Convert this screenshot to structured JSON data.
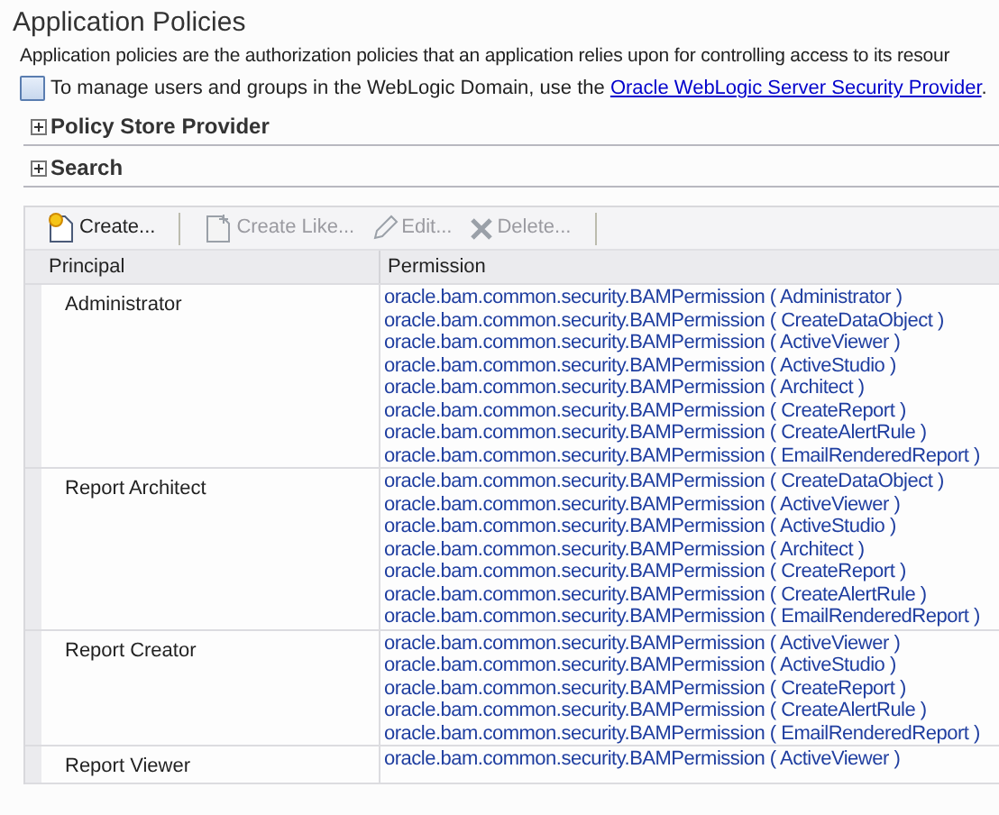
{
  "page_title": "Application Policies",
  "description": "Application policies are the authorization policies that an application relies upon for controlling access to its resour",
  "info": {
    "text": "To manage users and groups in the WebLogic Domain, use the ",
    "link": "Oracle WebLogic Server Security Provider",
    "after": "."
  },
  "sections": [
    {
      "label": "Policy Store Provider",
      "expanded": false
    },
    {
      "label": "Search",
      "expanded": false
    }
  ],
  "toolbar": [
    {
      "kind": "create",
      "label": "Create...",
      "disabled": false
    },
    {
      "kind": "create_like",
      "label": "Create Like...",
      "disabled": true
    },
    {
      "kind": "edit",
      "label": "Edit...",
      "disabled": true
    },
    {
      "kind": "delete",
      "label": "Delete...",
      "disabled": true
    }
  ],
  "table": {
    "columns": [
      "Principal",
      "Permission"
    ],
    "rows": [
      {
        "principal": "Administrator",
        "permissions": [
          "oracle.bam.common.security.BAMPermission ( Administrator )",
          "oracle.bam.common.security.BAMPermission ( CreateDataObject )",
          "oracle.bam.common.security.BAMPermission ( ActiveViewer )",
          "oracle.bam.common.security.BAMPermission ( ActiveStudio )",
          "oracle.bam.common.security.BAMPermission ( Architect )",
          "oracle.bam.common.security.BAMPermission ( CreateReport )",
          "oracle.bam.common.security.BAMPermission ( CreateAlertRule )",
          "oracle.bam.common.security.BAMPermission ( EmailRenderedReport )"
        ]
      },
      {
        "principal": "Report Architect",
        "permissions": [
          "oracle.bam.common.security.BAMPermission ( CreateDataObject )",
          "oracle.bam.common.security.BAMPermission ( ActiveViewer )",
          "oracle.bam.common.security.BAMPermission ( ActiveStudio )",
          "oracle.bam.common.security.BAMPermission ( Architect )",
          "oracle.bam.common.security.BAMPermission ( CreateReport )",
          "oracle.bam.common.security.BAMPermission ( CreateAlertRule )",
          "oracle.bam.common.security.BAMPermission ( EmailRenderedReport )"
        ]
      },
      {
        "principal": "Report Creator",
        "permissions": [
          "oracle.bam.common.security.BAMPermission ( ActiveViewer )",
          "oracle.bam.common.security.BAMPermission ( ActiveStudio )",
          "oracle.bam.common.security.BAMPermission ( CreateReport )",
          "oracle.bam.common.security.BAMPermission ( CreateAlertRule )",
          "oracle.bam.common.security.BAMPermission ( EmailRenderedReport )"
        ]
      },
      {
        "principal": "Report Viewer",
        "permissions": [
          "oracle.bam.common.security.BAMPermission ( ActiveViewer )"
        ]
      }
    ]
  }
}
